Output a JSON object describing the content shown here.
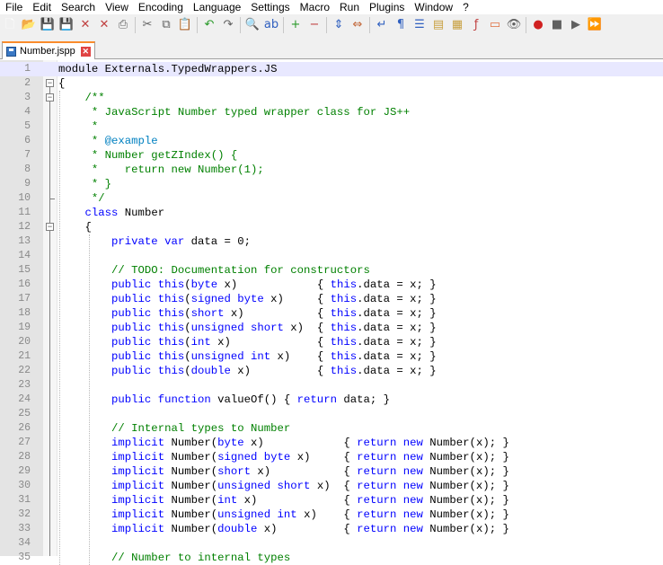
{
  "menubar": {
    "items": [
      "File",
      "Edit",
      "Search",
      "View",
      "Encoding",
      "Language",
      "Settings",
      "Macro",
      "Run",
      "Plugins",
      "Window",
      "?"
    ]
  },
  "toolbar": {
    "buttons": [
      {
        "name": "new-file",
        "glyph": "🗋",
        "color": "#ffffff"
      },
      {
        "name": "open-file",
        "glyph": "📂",
        "color": "#e8b84a"
      },
      {
        "name": "save",
        "glyph": "💾",
        "color": "#3a78c4"
      },
      {
        "name": "save-all",
        "glyph": "💾",
        "color": "#3a78c4"
      },
      {
        "name": "close",
        "glyph": "✕",
        "color": "#c04040"
      },
      {
        "name": "close-all",
        "glyph": "✕",
        "color": "#c04040"
      },
      {
        "name": "print",
        "glyph": "⎙",
        "color": "#606060"
      },
      {
        "sep": true
      },
      {
        "name": "cut",
        "glyph": "✂",
        "color": "#606060"
      },
      {
        "name": "copy",
        "glyph": "⧉",
        "color": "#606060"
      },
      {
        "name": "paste",
        "glyph": "📋",
        "color": "#c8a040"
      },
      {
        "sep": true
      },
      {
        "name": "undo",
        "glyph": "↶",
        "color": "#2a9a2a"
      },
      {
        "name": "redo",
        "glyph": "↷",
        "color": "#606060"
      },
      {
        "sep": true
      },
      {
        "name": "find",
        "glyph": "🔍",
        "color": "#404040"
      },
      {
        "name": "replace",
        "glyph": "ab",
        "color": "#3060c0"
      },
      {
        "sep": true
      },
      {
        "name": "zoom-in",
        "glyph": "+",
        "color": "#2a9a2a"
      },
      {
        "name": "zoom-out",
        "glyph": "−",
        "color": "#c04040"
      },
      {
        "sep": true
      },
      {
        "name": "sync-vertical",
        "glyph": "⇕",
        "color": "#3060c0"
      },
      {
        "name": "sync-horizontal",
        "glyph": "⇔",
        "color": "#c06030"
      },
      {
        "sep": true
      },
      {
        "name": "word-wrap",
        "glyph": "↵",
        "color": "#3060c0"
      },
      {
        "name": "show-all-chars",
        "glyph": "¶",
        "color": "#3060c0"
      },
      {
        "name": "indent-guide",
        "glyph": "☰",
        "color": "#3060c0"
      },
      {
        "name": "udl",
        "glyph": "▤",
        "color": "#c8a040"
      },
      {
        "name": "doc-map",
        "glyph": "▦",
        "color": "#c8a040"
      },
      {
        "name": "function-list",
        "glyph": "ƒ",
        "color": "#c04040"
      },
      {
        "name": "folder-workspace",
        "glyph": "▭",
        "color": "#e07040"
      },
      {
        "name": "monitoring",
        "glyph": "👁",
        "color": "#606060"
      },
      {
        "sep": true
      },
      {
        "name": "record-macro",
        "glyph": "●",
        "color": "#d02020"
      },
      {
        "name": "stop-recording",
        "glyph": "■",
        "color": "#606060"
      },
      {
        "name": "play-macro",
        "glyph": "▶",
        "color": "#606060"
      },
      {
        "name": "run-macro-multiple",
        "glyph": "⏩",
        "color": "#606060"
      }
    ]
  },
  "tabs": [
    {
      "label": "Number.jspp",
      "active": true
    }
  ],
  "editor": {
    "current_line": 1,
    "lines": [
      {
        "n": 1,
        "segs": [
          [
            "",
            "module Externals.TypedWrappers.JS"
          ]
        ]
      },
      {
        "n": 2,
        "segs": [
          [
            "",
            "{"
          ]
        ]
      },
      {
        "n": 3,
        "segs": [
          [
            "cm",
            "    /**"
          ]
        ]
      },
      {
        "n": 4,
        "segs": [
          [
            "cm",
            "     * JavaScript Number typed wrapper class for JS++"
          ]
        ]
      },
      {
        "n": 5,
        "segs": [
          [
            "cm",
            "     *"
          ]
        ]
      },
      {
        "n": 6,
        "segs": [
          [
            "cm",
            "     * "
          ],
          [
            "doc",
            "@example"
          ]
        ]
      },
      {
        "n": 7,
        "segs": [
          [
            "cm",
            "     * Number getZIndex() {"
          ]
        ]
      },
      {
        "n": 8,
        "segs": [
          [
            "cm",
            "     *    return new Number(1);"
          ]
        ]
      },
      {
        "n": 9,
        "segs": [
          [
            "cm",
            "     * }"
          ]
        ]
      },
      {
        "n": 10,
        "segs": [
          [
            "cm",
            "     */"
          ]
        ]
      },
      {
        "n": 11,
        "segs": [
          [
            "kw",
            "    class"
          ],
          [
            "",
            " Number"
          ]
        ]
      },
      {
        "n": 12,
        "segs": [
          [
            "",
            "    {"
          ]
        ]
      },
      {
        "n": 13,
        "segs": [
          [
            "kw",
            "        private var"
          ],
          [
            "",
            " data = 0;"
          ]
        ]
      },
      {
        "n": 14,
        "segs": [
          [
            "",
            ""
          ]
        ]
      },
      {
        "n": 15,
        "segs": [
          [
            "cm",
            "        // TODO: Documentation for constructors"
          ]
        ]
      },
      {
        "n": 16,
        "segs": [
          [
            "kw",
            "        public this"
          ],
          [
            "",
            "("
          ],
          [
            "kw",
            "byte"
          ],
          [
            "",
            " x)            { "
          ],
          [
            "kw",
            "this"
          ],
          [
            "",
            ".data = x; }"
          ]
        ]
      },
      {
        "n": 17,
        "segs": [
          [
            "kw",
            "        public this"
          ],
          [
            "",
            "("
          ],
          [
            "kw",
            "signed byte"
          ],
          [
            "",
            " x)     { "
          ],
          [
            "kw",
            "this"
          ],
          [
            "",
            ".data = x; }"
          ]
        ]
      },
      {
        "n": 18,
        "segs": [
          [
            "kw",
            "        public this"
          ],
          [
            "",
            "("
          ],
          [
            "kw",
            "short"
          ],
          [
            "",
            " x)           { "
          ],
          [
            "kw",
            "this"
          ],
          [
            "",
            ".data = x; }"
          ]
        ]
      },
      {
        "n": 19,
        "segs": [
          [
            "kw",
            "        public this"
          ],
          [
            "",
            "("
          ],
          [
            "kw",
            "unsigned short"
          ],
          [
            "",
            " x)  { "
          ],
          [
            "kw",
            "this"
          ],
          [
            "",
            ".data = x; }"
          ]
        ]
      },
      {
        "n": 20,
        "segs": [
          [
            "kw",
            "        public this"
          ],
          [
            "",
            "("
          ],
          [
            "kw",
            "int"
          ],
          [
            "",
            " x)             { "
          ],
          [
            "kw",
            "this"
          ],
          [
            "",
            ".data = x; }"
          ]
        ]
      },
      {
        "n": 21,
        "segs": [
          [
            "kw",
            "        public this"
          ],
          [
            "",
            "("
          ],
          [
            "kw",
            "unsigned int"
          ],
          [
            "",
            " x)    { "
          ],
          [
            "kw",
            "this"
          ],
          [
            "",
            ".data = x; }"
          ]
        ]
      },
      {
        "n": 22,
        "segs": [
          [
            "kw",
            "        public this"
          ],
          [
            "",
            "("
          ],
          [
            "kw",
            "double"
          ],
          [
            "",
            " x)          { "
          ],
          [
            "kw",
            "this"
          ],
          [
            "",
            ".data = x; }"
          ]
        ]
      },
      {
        "n": 23,
        "segs": [
          [
            "",
            ""
          ]
        ]
      },
      {
        "n": 24,
        "segs": [
          [
            "kw",
            "        public function"
          ],
          [
            "",
            " valueOf() { "
          ],
          [
            "kw",
            "return"
          ],
          [
            "",
            " data; }"
          ]
        ]
      },
      {
        "n": 25,
        "segs": [
          [
            "",
            ""
          ]
        ]
      },
      {
        "n": 26,
        "segs": [
          [
            "cm",
            "        // Internal types to Number"
          ]
        ]
      },
      {
        "n": 27,
        "segs": [
          [
            "kw",
            "        implicit"
          ],
          [
            "",
            " Number("
          ],
          [
            "kw",
            "byte"
          ],
          [
            "",
            " x)            { "
          ],
          [
            "kw",
            "return new"
          ],
          [
            "",
            " Number(x); }"
          ]
        ]
      },
      {
        "n": 28,
        "segs": [
          [
            "kw",
            "        implicit"
          ],
          [
            "",
            " Number("
          ],
          [
            "kw",
            "signed byte"
          ],
          [
            "",
            " x)     { "
          ],
          [
            "kw",
            "return new"
          ],
          [
            "",
            " Number(x); }"
          ]
        ]
      },
      {
        "n": 29,
        "segs": [
          [
            "kw",
            "        implicit"
          ],
          [
            "",
            " Number("
          ],
          [
            "kw",
            "short"
          ],
          [
            "",
            " x)           { "
          ],
          [
            "kw",
            "return new"
          ],
          [
            "",
            " Number(x); }"
          ]
        ]
      },
      {
        "n": 30,
        "segs": [
          [
            "kw",
            "        implicit"
          ],
          [
            "",
            " Number("
          ],
          [
            "kw",
            "unsigned short"
          ],
          [
            "",
            " x)  { "
          ],
          [
            "kw",
            "return new"
          ],
          [
            "",
            " Number(x); }"
          ]
        ]
      },
      {
        "n": 31,
        "segs": [
          [
            "kw",
            "        implicit"
          ],
          [
            "",
            " Number("
          ],
          [
            "kw",
            "int"
          ],
          [
            "",
            " x)             { "
          ],
          [
            "kw",
            "return new"
          ],
          [
            "",
            " Number(x); }"
          ]
        ]
      },
      {
        "n": 32,
        "segs": [
          [
            "kw",
            "        implicit"
          ],
          [
            "",
            " Number("
          ],
          [
            "kw",
            "unsigned int"
          ],
          [
            "",
            " x)    { "
          ],
          [
            "kw",
            "return new"
          ],
          [
            "",
            " Number(x); }"
          ]
        ]
      },
      {
        "n": 33,
        "segs": [
          [
            "kw",
            "        implicit"
          ],
          [
            "",
            " Number("
          ],
          [
            "kw",
            "double"
          ],
          [
            "",
            " x)          { "
          ],
          [
            "kw",
            "return new"
          ],
          [
            "",
            " Number(x); }"
          ]
        ]
      },
      {
        "n": 34,
        "segs": [
          [
            "",
            ""
          ]
        ]
      },
      {
        "n": 35,
        "segs": [
          [
            "cm",
            "        // Number to internal types"
          ]
        ]
      }
    ]
  },
  "colors": {
    "keyword": "#0000ff",
    "comment": "#008000",
    "doc_tag": "#0080c0",
    "current_line": "#e8e8ff",
    "tab_accent": "#fa8c2c"
  }
}
